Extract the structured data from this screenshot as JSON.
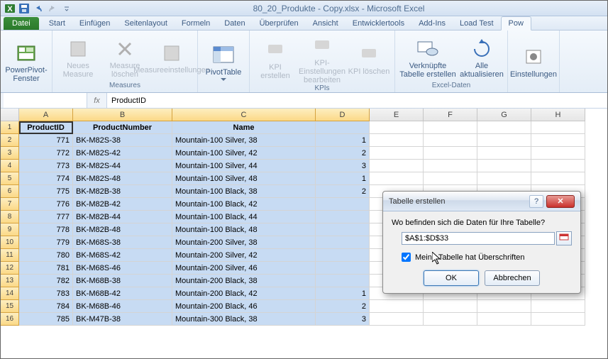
{
  "title": "80_20_Produkte - Copy.xlsx  -  Microsoft Excel",
  "tabs": {
    "file": "Datei",
    "list": [
      "Start",
      "Einfügen",
      "Seitenlayout",
      "Formeln",
      "Daten",
      "Überprüfen",
      "Ansicht",
      "Entwicklertools",
      "Add-Ins",
      "Load Test",
      "Pow"
    ]
  },
  "ribbon": {
    "g1": {
      "btn": "PowerPivot-Fenster"
    },
    "g2": {
      "label": "Measures",
      "b1": "Neues Measure",
      "b2": "Measure löschen",
      "b3": "Measureeinstellungen"
    },
    "g3": {
      "btn": "PivotTable"
    },
    "g4": {
      "label": "KPIs",
      "b1": "KPI erstellen",
      "b2": "KPI-Einstellungen bearbeiten",
      "b3": "KPI löschen"
    },
    "g5": {
      "label": "Excel-Daten",
      "b1": "Verknüpfte Tabelle erstellen",
      "b2": "Alle aktualisieren"
    },
    "g6": {
      "btn": "Einstellungen"
    }
  },
  "fx": {
    "value": "ProductID",
    "label": "fx"
  },
  "cols": [
    "A",
    "B",
    "C",
    "D",
    "E",
    "F",
    "G",
    "H"
  ],
  "headers": [
    "ProductID",
    "ProductNumber",
    "Name",
    ""
  ],
  "rows": [
    {
      "n": 1
    },
    {
      "n": 2,
      "a": "771",
      "b": "BK-M82S-38",
      "c": "Mountain-100 Silver, 38",
      "d": "1"
    },
    {
      "n": 3,
      "a": "772",
      "b": "BK-M82S-42",
      "c": "Mountain-100 Silver, 42",
      "d": "2"
    },
    {
      "n": 4,
      "a": "773",
      "b": "BK-M82S-44",
      "c": "Mountain-100 Silver, 44",
      "d": "3"
    },
    {
      "n": 5,
      "a": "774",
      "b": "BK-M82S-48",
      "c": "Mountain-100 Silver, 48",
      "d": "1"
    },
    {
      "n": 6,
      "a": "775",
      "b": "BK-M82B-38",
      "c": "Mountain-100 Black, 38",
      "d": "2"
    },
    {
      "n": 7,
      "a": "776",
      "b": "BK-M82B-42",
      "c": "Mountain-100 Black, 42",
      "d": ""
    },
    {
      "n": 8,
      "a": "777",
      "b": "BK-M82B-44",
      "c": "Mountain-100 Black, 44",
      "d": ""
    },
    {
      "n": 9,
      "a": "778",
      "b": "BK-M82B-48",
      "c": "Mountain-100 Black, 48",
      "d": ""
    },
    {
      "n": 10,
      "a": "779",
      "b": "BK-M68S-38",
      "c": "Mountain-200 Silver, 38",
      "d": ""
    },
    {
      "n": 11,
      "a": "780",
      "b": "BK-M68S-42",
      "c": "Mountain-200 Silver, 42",
      "d": ""
    },
    {
      "n": 12,
      "a": "781",
      "b": "BK-M68S-46",
      "c": "Mountain-200 Silver, 46",
      "d": ""
    },
    {
      "n": 13,
      "a": "782",
      "b": "BK-M68B-38",
      "c": "Mountain-200 Black, 38",
      "d": ""
    },
    {
      "n": 14,
      "a": "783",
      "b": "BK-M68B-42",
      "c": "Mountain-200 Black, 42",
      "d": "1"
    },
    {
      "n": 15,
      "a": "784",
      "b": "BK-M68B-46",
      "c": "Mountain-200 Black, 46",
      "d": "2"
    },
    {
      "n": 16,
      "a": "785",
      "b": "BK-M47B-38",
      "c": "Mountain-300 Black, 38",
      "d": "3"
    }
  ],
  "dialog": {
    "title": "Tabelle erstellen",
    "prompt": "Wo befinden sich die Daten für Ihre Tabelle?",
    "range": "$A$1:$D$33",
    "check": "Meine Tabelle hat Überschriften",
    "ok": "OK",
    "cancel": "Abbrechen"
  }
}
